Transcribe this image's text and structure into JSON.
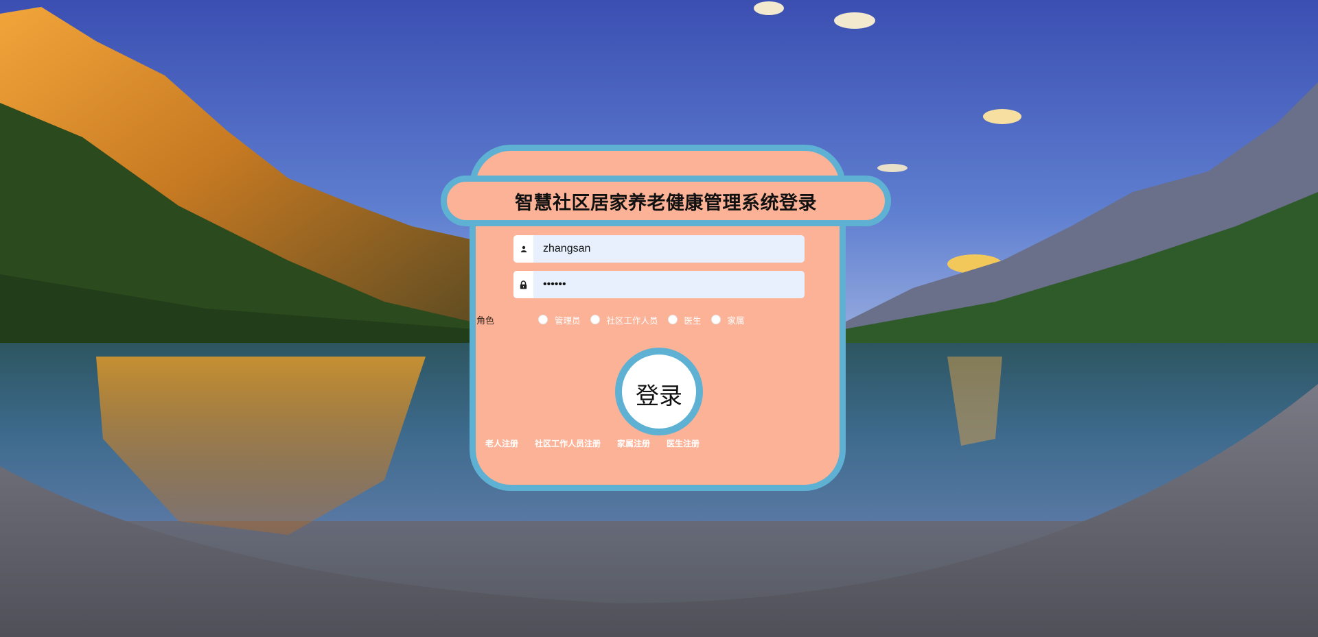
{
  "page": {
    "title": "智慧社区居家养老健康管理系统登录"
  },
  "form": {
    "username": {
      "value": "zhangsan",
      "icon": "user-icon"
    },
    "password": {
      "value": "123456",
      "icon": "lock-icon"
    },
    "role_label": "角色",
    "roles": [
      "管理员",
      "社区工作人员",
      "医生",
      "家属"
    ],
    "login_label": "登录"
  },
  "register_links": [
    "老人注册",
    "社区工作人员注册",
    "家属注册",
    "医生注册"
  ],
  "colors": {
    "card_fill": "#fcb296",
    "card_border": "#5eb1d2",
    "input_bg": "#e8f0fe"
  }
}
